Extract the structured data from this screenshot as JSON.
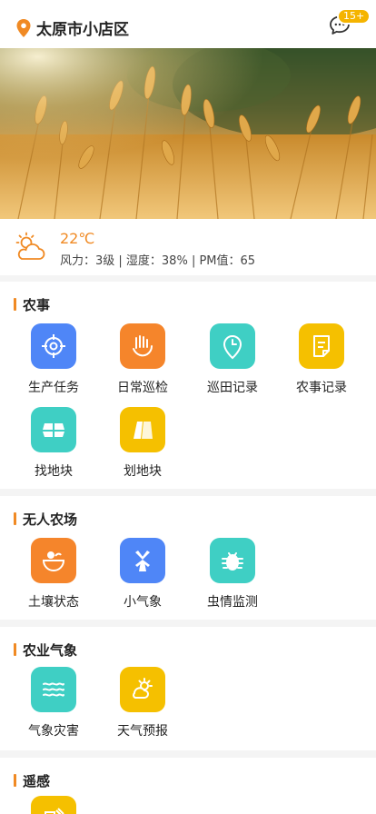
{
  "header": {
    "location": "太原市小店区",
    "badge": "15+"
  },
  "weather": {
    "temperature": "22℃",
    "detail": "风力：3级 | 湿度：38% | PM值：65"
  },
  "sections": [
    {
      "title": "农事",
      "items": [
        {
          "label": "生产任务",
          "icon": "target-icon",
          "color": "#4f86f7"
        },
        {
          "label": "日常巡检",
          "icon": "hand-icon",
          "color": "#f5852b"
        },
        {
          "label": "巡田记录",
          "icon": "clock-pin-icon",
          "color": "#3fcfc4"
        },
        {
          "label": "农事记录",
          "icon": "document-icon",
          "color": "#f5c000"
        },
        {
          "label": "找地块",
          "icon": "land-plot-icon",
          "color": "#3fcfc4"
        },
        {
          "label": "划地块",
          "icon": "map-draw-icon",
          "color": "#f5c000"
        }
      ]
    },
    {
      "title": "无人农场",
      "items": [
        {
          "label": "土壤状态",
          "icon": "soil-icon",
          "color": "#f5852b"
        },
        {
          "label": "小气象",
          "icon": "windmill-icon",
          "color": "#4f86f7"
        },
        {
          "label": "虫情监测",
          "icon": "bug-icon",
          "color": "#3fcfc4"
        }
      ]
    },
    {
      "title": "农业气象",
      "items": [
        {
          "label": "气象灾害",
          "icon": "waves-icon",
          "color": "#3fcfc4"
        },
        {
          "label": "天气预报",
          "icon": "sun-cloud-icon",
          "color": "#f5c000"
        }
      ]
    },
    {
      "title": "遥感",
      "items": [
        {
          "label": "",
          "icon": "remote-sensing-icon",
          "color": "#f5c000"
        }
      ]
    }
  ]
}
